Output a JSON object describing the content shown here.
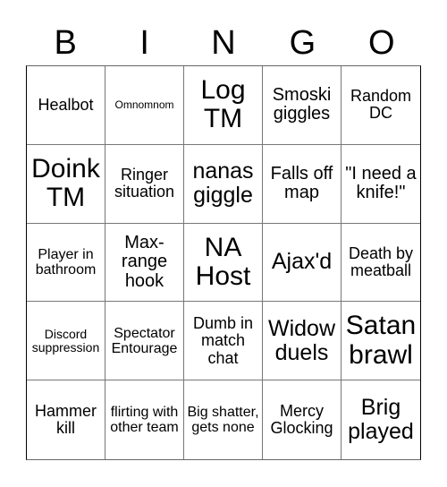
{
  "header": [
    "B",
    "I",
    "N",
    "G",
    "O"
  ],
  "cells": [
    {
      "text": "Healbot",
      "size": "s4"
    },
    {
      "text": "Omnomnom",
      "size": "s1"
    },
    {
      "text": "Log TM",
      "size": "s8"
    },
    {
      "text": "Smoski giggles",
      "size": "s5"
    },
    {
      "text": "Random DC",
      "size": "s4"
    },
    {
      "text": "Doink TM",
      "size": "s8"
    },
    {
      "text": "Ringer situation",
      "size": "s4"
    },
    {
      "text": "nanas giggle",
      "size": "s7"
    },
    {
      "text": "Falls off map",
      "size": "s5"
    },
    {
      "text": "\"I need a knife!\"",
      "size": "s5"
    },
    {
      "text": "Player in bathroom",
      "size": "s3"
    },
    {
      "text": "Max-range hook",
      "size": "s5"
    },
    {
      "text": "NA Host",
      "size": "s8"
    },
    {
      "text": "Ajax'd",
      "size": "s7"
    },
    {
      "text": "Death by meatball",
      "size": "s4"
    },
    {
      "text": "Discord suppression",
      "size": "s2"
    },
    {
      "text": "Spectator Entourage",
      "size": "s3"
    },
    {
      "text": "Dumb in match chat",
      "size": "s4"
    },
    {
      "text": "Widow duels",
      "size": "s7"
    },
    {
      "text": "Satan brawl",
      "size": "s8"
    },
    {
      "text": "Hammer kill",
      "size": "s4"
    },
    {
      "text": "flirting with other team",
      "size": "s3"
    },
    {
      "text": "Big shatter, gets none",
      "size": "s3"
    },
    {
      "text": "Mercy Glocking",
      "size": "s4"
    },
    {
      "text": "Brig played",
      "size": "s7"
    }
  ]
}
